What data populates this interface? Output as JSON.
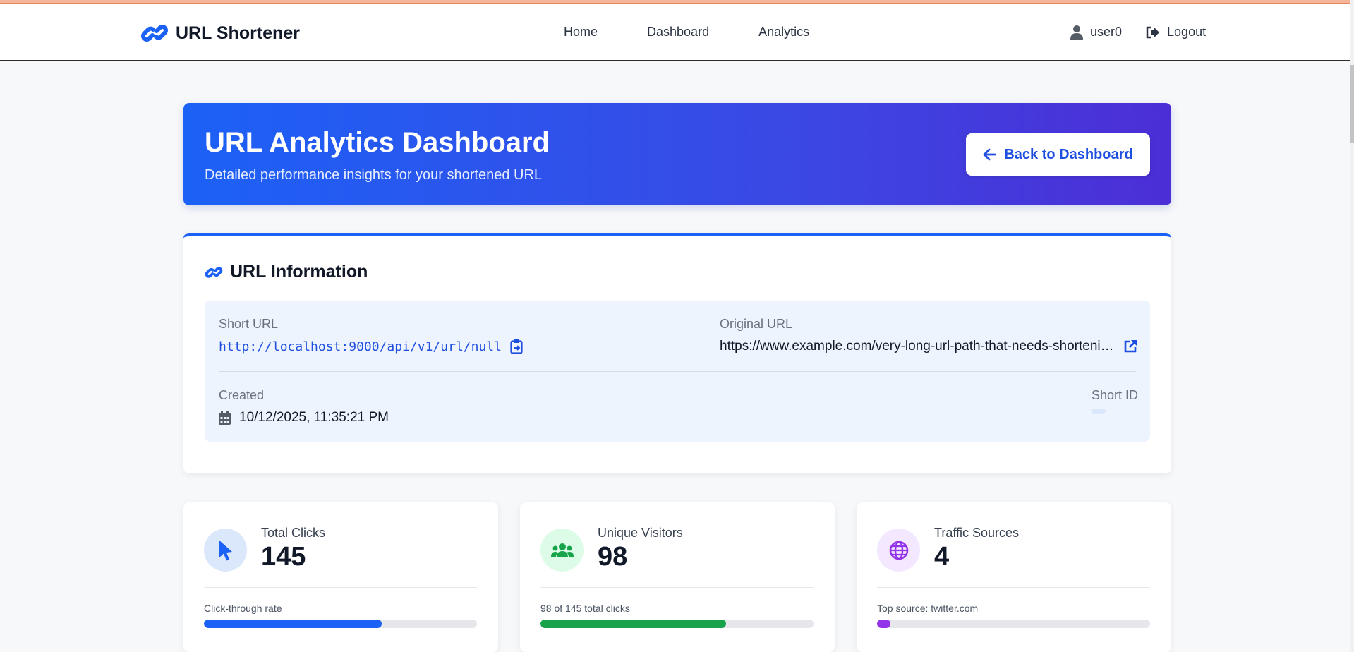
{
  "nav": {
    "brand": "URL Shortener",
    "links": [
      "Home",
      "Dashboard",
      "Analytics"
    ],
    "user": "user0",
    "logout": "Logout"
  },
  "hero": {
    "title": "URL Analytics Dashboard",
    "subtitle": "Detailed performance insights for your shortened URL",
    "back_button": "Back to Dashboard"
  },
  "info": {
    "title": "URL Information",
    "short_url_label": "Short URL",
    "short_url": "http://localhost:9000/api/v1/url/null",
    "original_url_label": "Original URL",
    "original_url": "https://www.example.com/very-long-url-path-that-needs-shortening",
    "created_label": "Created",
    "created": "10/12/2025, 11:35:21 PM",
    "short_id_label": "Short ID"
  },
  "stats": [
    {
      "label": "Total Clicks",
      "value": "145",
      "footer": "Click-through rate",
      "progress": 0.65,
      "color": "#1c61f6",
      "icon": "cursor-icon",
      "icon_bg": "#dbe7fb"
    },
    {
      "label": "Unique Visitors",
      "value": "98",
      "footer": "98 of 145 total clicks",
      "progress": 0.68,
      "color": "#16a34a",
      "icon": "users-icon",
      "icon_bg": "#dcfce7"
    },
    {
      "label": "Traffic Sources",
      "value": "4",
      "footer": "Top source: twitter.com",
      "progress": 0.05,
      "color": "#9333ea",
      "icon": "globe-icon",
      "icon_bg": "#f3e8ff"
    }
  ],
  "colors": {
    "primary": "#1c61f6",
    "gradient_end": "#4c2ed6"
  }
}
